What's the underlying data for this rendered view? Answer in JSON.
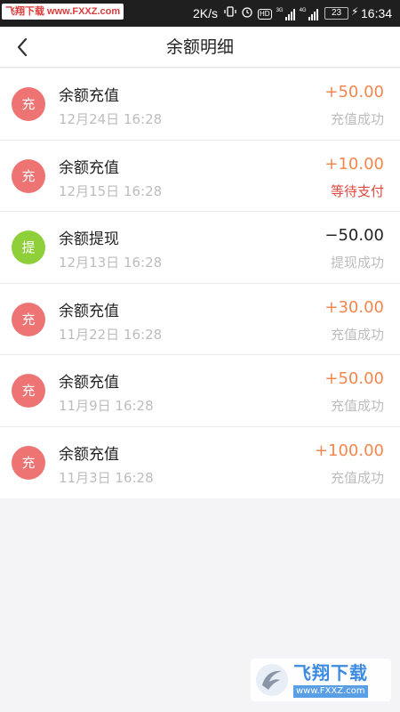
{
  "status_bar": {
    "watermark": "飞翔下载 www.FXXZ.com",
    "speed": "2K/s",
    "battery": "23",
    "time": "16:34"
  },
  "header": {
    "title": "余额明细"
  },
  "transactions": [
    {
      "badge": "充",
      "badge_color": "#ee7474",
      "name": "余额充值",
      "date": "12月24日 16:28",
      "amount": "+50.00",
      "amount_color": "#f0874f",
      "status": "充值成功",
      "status_color": "#bdbdbd"
    },
    {
      "badge": "充",
      "badge_color": "#ee7474",
      "name": "余额充值",
      "date": "12月15日 16:28",
      "amount": "+10.00",
      "amount_color": "#f0874f",
      "status": "等待支付",
      "status_color": "#e04a3f"
    },
    {
      "badge": "提",
      "badge_color": "#8fcf3a",
      "name": "余额提现",
      "date": "12月13日 16:28",
      "amount": "−50.00",
      "amount_color": "#222222",
      "status": "提现成功",
      "status_color": "#bdbdbd"
    },
    {
      "badge": "充",
      "badge_color": "#ee7474",
      "name": "余额充值",
      "date": "11月22日 16:28",
      "amount": "+30.00",
      "amount_color": "#f0874f",
      "status": "充值成功",
      "status_color": "#bdbdbd"
    },
    {
      "badge": "充",
      "badge_color": "#ee7474",
      "name": "余额充值",
      "date": "11月9日 16:28",
      "amount": "+50.00",
      "amount_color": "#f0874f",
      "status": "充值成功",
      "status_color": "#bdbdbd"
    },
    {
      "badge": "充",
      "badge_color": "#ee7474",
      "name": "余额充值",
      "date": "11月3日 16:28",
      "amount": "+100.00",
      "amount_color": "#f0874f",
      "status": "充值成功",
      "status_color": "#bdbdbd"
    }
  ],
  "footer_logo": {
    "name": "飞翔下载",
    "url": "www.FXXZ.com"
  }
}
